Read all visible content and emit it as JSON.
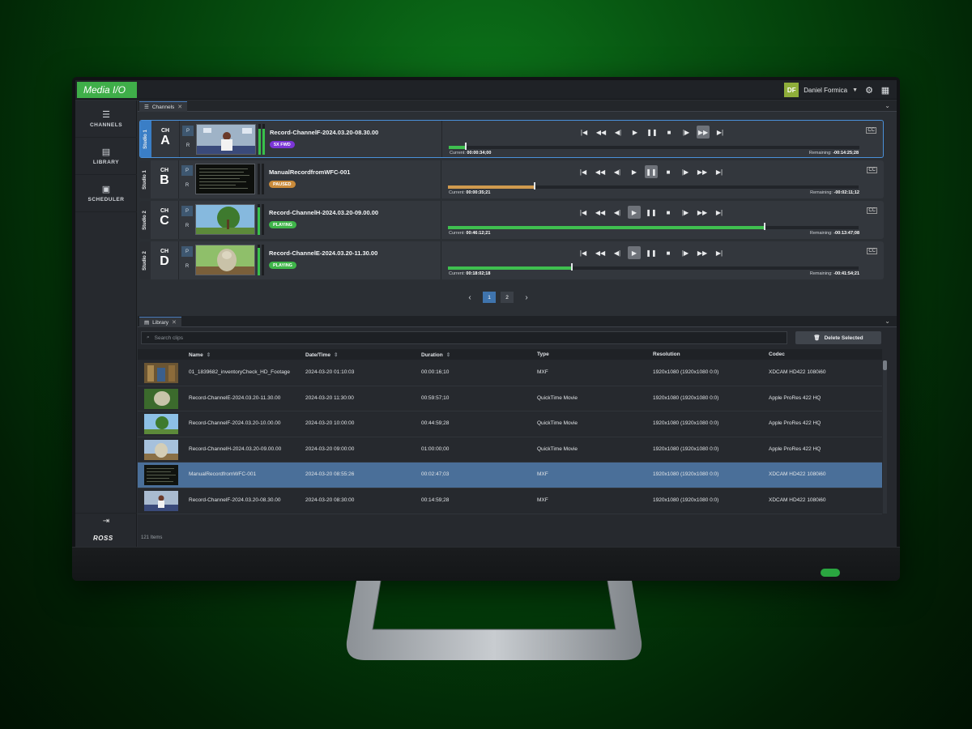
{
  "app": {
    "brand": "Media I/O"
  },
  "user": {
    "initials": "DF",
    "name": "Daniel Formica"
  },
  "sidebar": {
    "items": [
      {
        "label": "CHANNELS",
        "icon": "list-icon"
      },
      {
        "label": "LIBRARY",
        "icon": "book-icon"
      },
      {
        "label": "SCHEDULER",
        "icon": "calendar-icon"
      }
    ],
    "logo": "ROSS"
  },
  "channels_panel": {
    "tab_label": "Channels",
    "channels": [
      {
        "studio": "Studio 1",
        "ch_prefix": "CH",
        "ch_letter": "A",
        "clip": "Record-ChannelF-2024.03.20-08.30.00",
        "badge": "5X FWD",
        "badge_color": "#7b35d6",
        "current_label": "Current:",
        "current": "00:00:34;00",
        "remaining_label": "Remaining:",
        "remaining": "-00:14:25;28",
        "progress": 0.04,
        "progress_color": "#3fbf4f",
        "meter1": 0.85,
        "meter2": 0.85,
        "active_btn": 6
      },
      {
        "studio": "Studio 1",
        "ch_prefix": "CH",
        "ch_letter": "B",
        "clip": "ManualRecordfromWFC-001",
        "badge": "PAUSED",
        "badge_color": "#c98a3a",
        "current_label": "Current:",
        "current": "00:00:35;21",
        "remaining_label": "Remaining:",
        "remaining": "-00:02:11;12",
        "progress": 0.21,
        "progress_color": "#d09a4e",
        "meter1": 0,
        "meter2": 0,
        "active_btn": 4
      },
      {
        "studio": "Studio 2",
        "ch_prefix": "CH",
        "ch_letter": "C",
        "clip": "Record-ChannelH-2024.03.20-09.00.00",
        "badge": "PLAYING",
        "badge_color": "#3fb549",
        "current_label": "Current:",
        "current": "00:46:12;21",
        "remaining_label": "Remaining:",
        "remaining": "-00:13:47;08",
        "progress": 0.77,
        "progress_color": "#3fbf4f",
        "meter1": 0.9,
        "meter2": 0,
        "active_btn": 3
      },
      {
        "studio": "Studio 2",
        "ch_prefix": "CH",
        "ch_letter": "D",
        "clip": "Record-ChannelE-2024.03.20-11.30.00",
        "badge": "PLAYING",
        "badge_color": "#3fb549",
        "current_label": "Current:",
        "current": "00:18:02;18",
        "remaining_label": "Remaining:",
        "remaining": "-00:41:54;21",
        "progress": 0.3,
        "progress_color": "#3fbf4f",
        "meter1": 0.9,
        "meter2": 0,
        "active_btn": 3
      }
    ],
    "pages": [
      "1",
      "2"
    ],
    "current_page": "1"
  },
  "library": {
    "tab_label": "Library",
    "search_placeholder": "Search clips",
    "delete_label": "Delete Selected",
    "columns": [
      "Name",
      "Date/Time",
      "Duration",
      "Type",
      "Resolution",
      "Codec"
    ],
    "rows": [
      {
        "name": "01_1839682_inventoryCheck_HD_Footage",
        "datetime": "2024-03-20 01:10:03",
        "duration": "00:00:16;10",
        "type": "MXF",
        "resolution": "1920x1080 (1920x1080 0:0)",
        "codec": "XDCAM HD422 1080i60",
        "thumb": "warehouse"
      },
      {
        "name": "Record-ChannelE-2024.03.20-11.30.00",
        "datetime": "2024-03-20 11:30:00",
        "duration": "00:59:57;10",
        "type": "QuickTime Movie",
        "resolution": "1920x1080 (1920x1080 0:0)",
        "codec": "Apple ProRes 422 HQ",
        "thumb": "green"
      },
      {
        "name": "Record-ChannelF-2024.03.20-10.00.00",
        "datetime": "2024-03-20 10:00:00",
        "duration": "00:44:59;28",
        "type": "QuickTime Movie",
        "resolution": "1920x1080 (1920x1080 0:0)",
        "codec": "Apple ProRes 422 HQ",
        "thumb": "sky"
      },
      {
        "name": "Record-ChannelH-2024.03.20-09.00.00",
        "datetime": "2024-03-20 09:00:00",
        "duration": "01:00:00;00",
        "type": "QuickTime Movie",
        "resolution": "1920x1080 (1920x1080 0:0)",
        "codec": "Apple ProRes 422 HQ",
        "thumb": "goat"
      },
      {
        "name": "ManualRecordfromWFC-001",
        "datetime": "2024-03-20 08:55:26",
        "duration": "00:02:47;03",
        "type": "MXF",
        "resolution": "1920x1080 (1920x1080 0:0)",
        "codec": "XDCAM HD422 1080i60",
        "thumb": "dark",
        "selected": true
      },
      {
        "name": "Record-ChannelF-2024.03.20-08.30.00",
        "datetime": "2024-03-20 08:30:00",
        "duration": "00:14:59;28",
        "type": "MXF",
        "resolution": "1920x1080 (1920x1080 0:0)",
        "codec": "XDCAM HD422 1080i60",
        "thumb": "studio"
      }
    ],
    "count": "121 Items"
  },
  "colors": {
    "brand": "#3fae49",
    "accent": "#3a7ec6",
    "selected_row": "#4a6f99"
  }
}
